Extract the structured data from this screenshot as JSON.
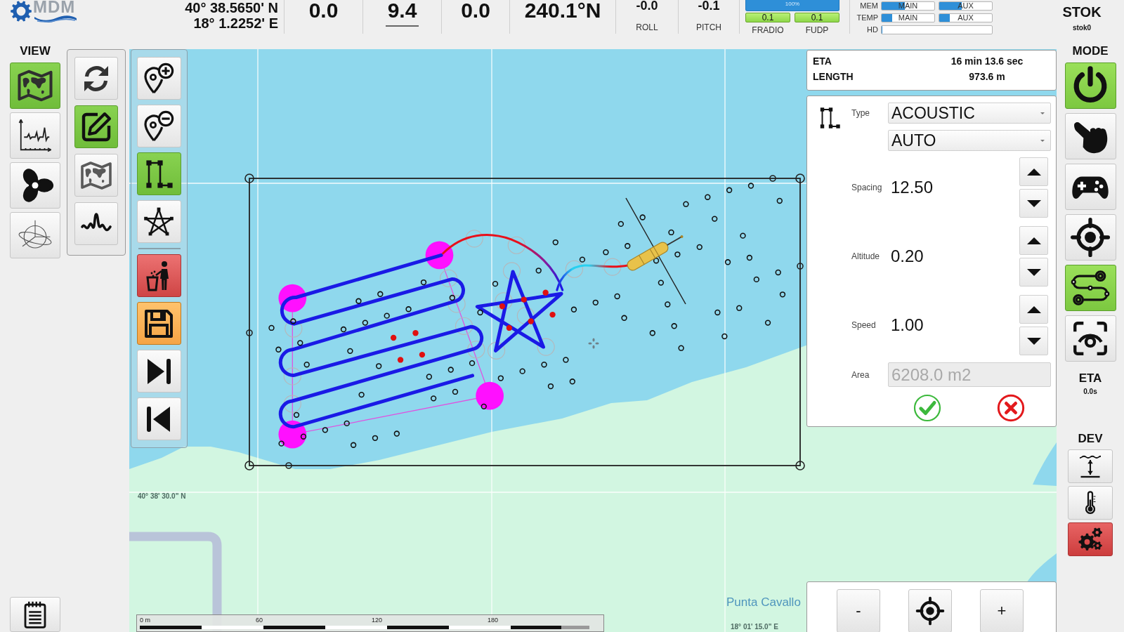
{
  "logo": {
    "text": "MDM"
  },
  "position": {
    "latitude": "40° 38.5650' N",
    "longitude": "18° 1.2252' E"
  },
  "readouts": [
    {
      "value": "0.0",
      "underlined": false
    },
    {
      "value": "9.4",
      "underlined": true
    },
    {
      "value": "0.0",
      "underlined": false
    },
    {
      "value": "240.1°N",
      "underlined": false
    }
  ],
  "attitude": [
    {
      "value": "-0.0",
      "label": "ROLL"
    },
    {
      "value": "-0.1",
      "label": "PITCH"
    }
  ],
  "link": {
    "bar": {
      "text": "100%",
      "level": 1
    },
    "channels": [
      {
        "value": "0.1",
        "label": "FRADIO"
      },
      {
        "value": "0.1",
        "label": "FUDP"
      }
    ]
  },
  "resources": [
    {
      "label": "MEM",
      "meters": [
        {
          "text": "MAIN",
          "level": 0.44
        },
        {
          "text": "AUX",
          "level": 0.43
        }
      ]
    },
    {
      "label": "TEMP",
      "meters": [
        {
          "text": "MAIN",
          "level": 0.2
        },
        {
          "text": "AUX",
          "level": 0.2
        }
      ]
    },
    {
      "label": "HD",
      "meters": [
        {
          "level": 0
        }
      ]
    }
  ],
  "vehicle": {
    "name": "STOK",
    "id": "stok0"
  },
  "view_panel": {
    "title": "VIEW",
    "buttons": [
      {
        "kind": "map",
        "selected": true
      },
      {
        "kind": "signal",
        "selected": false
      },
      {
        "kind": "propeller",
        "selected": false
      },
      {
        "kind": "attitude",
        "selected": false
      }
    ]
  },
  "edit_tools": [
    {
      "kind": "refresh",
      "on": false
    },
    {
      "kind": "edit",
      "on": true
    },
    {
      "kind": "map-outline",
      "on": false
    },
    {
      "kind": "wave",
      "on": false
    }
  ],
  "mission_tools": {
    "patterns": [
      {
        "kind": "add-point",
        "selected": false
      },
      {
        "kind": "remove-point",
        "selected": false
      },
      {
        "kind": "lawnmower",
        "selected": true
      },
      {
        "kind": "star",
        "selected": false
      }
    ],
    "actions": [
      {
        "kind": "delete"
      },
      {
        "kind": "save"
      },
      {
        "kind": "next"
      },
      {
        "kind": "previous"
      }
    ]
  },
  "map": {
    "grid_labels": [
      "40° 38' 30.0\" N",
      "18° 01' 15.0\" E"
    ],
    "place_label": "Punta Cavallo",
    "scale_ticks": [
      "0 m",
      "60",
      "120",
      "180"
    ]
  },
  "route_summary": [
    {
      "label": "ETA",
      "value": "16 min 13.6 sec"
    },
    {
      "label": "LENGTH",
      "value": "973.6 m"
    }
  ],
  "pattern_form": {
    "type": {
      "label": "Type",
      "value": "ACOUSTIC"
    },
    "mode": {
      "value": "AUTO"
    },
    "params": [
      {
        "label": "Spacing",
        "value": "12.50"
      },
      {
        "label": "Altitude",
        "value": "0.20"
      },
      {
        "label": "Speed",
        "value": "1.00"
      }
    ],
    "area": {
      "label": "Area",
      "value": "6208.0 m2",
      "disabled": true
    }
  },
  "zoom_controls": {
    "zoom_out": "-",
    "zoom_in": "+"
  },
  "mode_panel": {
    "title": "MODE",
    "buttons": [
      {
        "kind": "power",
        "on": true
      },
      {
        "kind": "manual",
        "on": false
      },
      {
        "kind": "gamepad",
        "on": false
      },
      {
        "kind": "target",
        "on": false
      },
      {
        "kind": "route",
        "on": true
      },
      {
        "kind": "camera",
        "on": false
      }
    ],
    "eta": {
      "label": "ETA",
      "value": "0.0s"
    }
  },
  "dev_panel": {
    "title": "DEV",
    "buttons": [
      {
        "kind": "depth",
        "alert": false
      },
      {
        "kind": "temperature",
        "alert": false
      },
      {
        "kind": "settings",
        "alert": true
      }
    ]
  }
}
